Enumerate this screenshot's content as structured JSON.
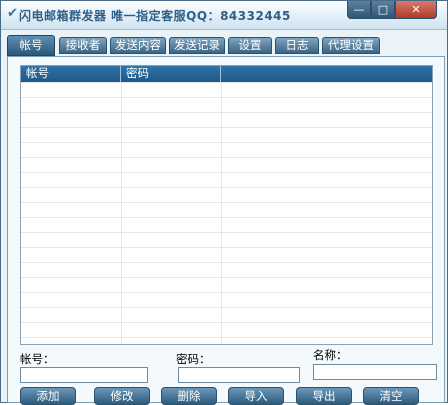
{
  "window": {
    "title": "闪电邮箱群发器  唯一指定客服QQ：84332445",
    "controls": {
      "minimize": "—",
      "maximize": "□",
      "close": "✕"
    }
  },
  "tabs": [
    "帐号",
    "接收者",
    "发送内容",
    "发送记录",
    "设置",
    "日志",
    "代理设置"
  ],
  "grid": {
    "columns": [
      "帐号",
      "密码",
      ""
    ],
    "rows": []
  },
  "form": {
    "account_label": "帐号：",
    "password_label": "密码：",
    "name_label": "名称：",
    "account_value": "",
    "password_value": "",
    "name_value": ""
  },
  "buttons": [
    "添加",
    "修改",
    "删除",
    "导入",
    "导出",
    "清空"
  ]
}
